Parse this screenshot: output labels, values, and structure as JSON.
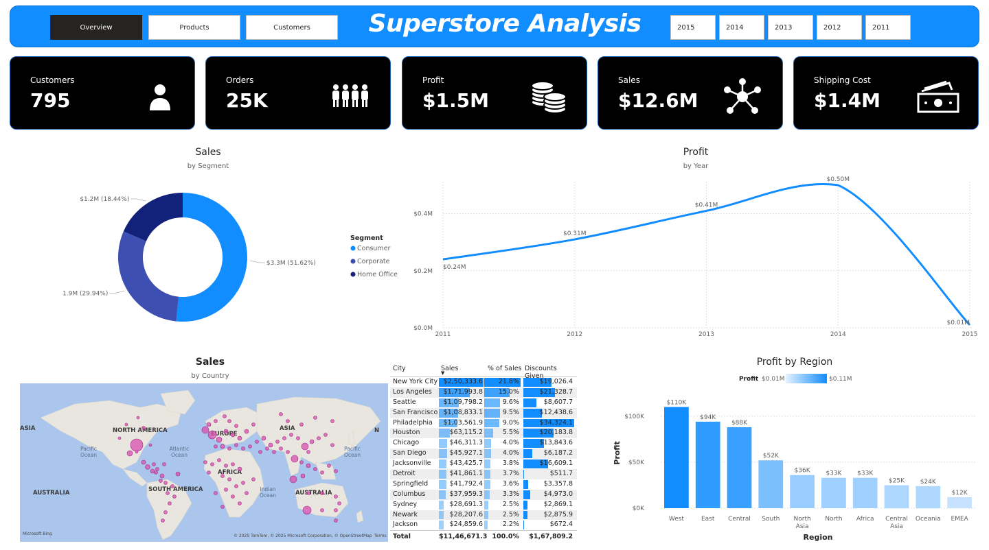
{
  "nav": {
    "tabs": [
      "Overview",
      "Products",
      "Customers"
    ],
    "active": "Overview",
    "title": "Superstore Analysis",
    "years": [
      "2015",
      "2014",
      "2013",
      "2012",
      "2011"
    ]
  },
  "kpis": [
    {
      "label": "Customers",
      "value": "795",
      "icon": "person-icon"
    },
    {
      "label": "Orders",
      "value": "25K",
      "icon": "people-group-icon"
    },
    {
      "label": "Profit",
      "value": "$1.5M",
      "icon": "coins-icon"
    },
    {
      "label": "Sales",
      "value": "$12.6M",
      "icon": "network-icon"
    },
    {
      "label": "Shipping Cost",
      "value": "$1.4M",
      "icon": "cash-icon"
    }
  ],
  "donut": {
    "title": "Sales",
    "subtitle": "by Segment",
    "legend_title": "Segment",
    "segments": [
      {
        "name": "Consumer",
        "value": 3.3,
        "label": "$3.3M (51.62%)",
        "pct": 51.62,
        "color": "#118dff"
      },
      {
        "name": "Corporate",
        "value": 1.9,
        "label": "$1.9M (29.94%)",
        "pct": 29.94,
        "color": "#3d4fb0"
      },
      {
        "name": "Home Office",
        "value": 1.2,
        "label": "$1.2M (18.44%)",
        "pct": 18.44,
        "color": "#12217a"
      }
    ]
  },
  "profit_line": {
    "title": "Profit",
    "subtitle": "by Year",
    "x": [
      2011,
      2012,
      2013,
      2014,
      2015
    ],
    "y": [
      0.24,
      0.31,
      0.41,
      0.5,
      0.01
    ],
    "labels": [
      "$0.24M",
      "$0.31M",
      "$0.41M",
      "$0.50M",
      "$0.01M"
    ],
    "yticks": [
      "$0.0M",
      "$0.2M",
      "$0.4M"
    ],
    "ylim": [
      0,
      0.5
    ],
    "color": "#118dff"
  },
  "map": {
    "title": "Sales",
    "subtitle": "by Country",
    "labels": {
      "na": "NORTH AMERICA",
      "eu": "EUROPE",
      "asia": "ASIA",
      "asia2": "ASIA",
      "asia3": "ASIA",
      "africa": "AFRICA",
      "sa": "SOUTH AMERICA",
      "au": "AUSTRALIA",
      "au2": "AUSTRALIA",
      "pacific1": "Pacific\nOcean",
      "atlantic": "Atlantic\nOcean",
      "indian": "Indian\nOcean",
      "pacific2": "Pacific\nOcean",
      "n": "N"
    },
    "bing": "Microsoft Bing",
    "copyright": "© 2025 TomTom, © 2025 Microsoft Corporation, © OpenStreetMap",
    "terms": "Terms"
  },
  "table": {
    "headers": [
      "City",
      "Sales",
      "% of Sales",
      "Discounts Given"
    ],
    "rows": [
      {
        "city": "New York City",
        "sales": "$2,50,333.6",
        "pct": "21.8%",
        "disc": "$19,026.4",
        "s": 1.0,
        "p": 1.0,
        "d": 0.55
      },
      {
        "city": "Los Angeles",
        "sales": "$1,71,993.8",
        "pct": "15.0%",
        "disc": "$21,328.7",
        "s": 0.69,
        "p": 0.69,
        "d": 0.62
      },
      {
        "city": "Seattle",
        "sales": "$1,09,798.2",
        "pct": "9.6%",
        "disc": "$8,607.7",
        "s": 0.44,
        "p": 0.44,
        "d": 0.25
      },
      {
        "city": "San Francisco",
        "sales": "$1,08,833.1",
        "pct": "9.5%",
        "disc": "$12,438.6",
        "s": 0.43,
        "p": 0.43,
        "d": 0.36
      },
      {
        "city": "Philadelphia",
        "sales": "$1,03,561.9",
        "pct": "9.0%",
        "disc": "$34,324.1",
        "s": 0.41,
        "p": 0.41,
        "d": 1.0
      },
      {
        "city": "Houston",
        "sales": "$63,115.2",
        "pct": "5.5%",
        "disc": "$20,183.8",
        "s": 0.25,
        "p": 0.25,
        "d": 0.59
      },
      {
        "city": "Chicago",
        "sales": "$46,311.3",
        "pct": "4.0%",
        "disc": "$13,843.6",
        "s": 0.18,
        "p": 0.18,
        "d": 0.4
      },
      {
        "city": "San Diego",
        "sales": "$45,927.1",
        "pct": "4.0%",
        "disc": "$6,187.2",
        "s": 0.18,
        "p": 0.18,
        "d": 0.18
      },
      {
        "city": "Jacksonville",
        "sales": "$43,425.7",
        "pct": "3.8%",
        "disc": "$16,609.1",
        "s": 0.17,
        "p": 0.17,
        "d": 0.48
      },
      {
        "city": "Detroit",
        "sales": "$41,861.1",
        "pct": "3.7%",
        "disc": "$511.7",
        "s": 0.17,
        "p": 0.17,
        "d": 0.01
      },
      {
        "city": "Springfield",
        "sales": "$41,792.4",
        "pct": "3.6%",
        "disc": "$3,357.8",
        "s": 0.17,
        "p": 0.17,
        "d": 0.1
      },
      {
        "city": "Columbus",
        "sales": "$37,959.3",
        "pct": "3.3%",
        "disc": "$4,973.0",
        "s": 0.15,
        "p": 0.15,
        "d": 0.14
      },
      {
        "city": "Sydney",
        "sales": "$28,691.3",
        "pct": "2.5%",
        "disc": "$2,869.1",
        "s": 0.11,
        "p": 0.11,
        "d": 0.08
      },
      {
        "city": "Newark",
        "sales": "$28,207.6",
        "pct": "2.5%",
        "disc": "$2,875.9",
        "s": 0.11,
        "p": 0.11,
        "d": 0.08
      },
      {
        "city": "Jackson",
        "sales": "$24,859.6",
        "pct": "2.2%",
        "disc": "$672.4",
        "s": 0.1,
        "p": 0.1,
        "d": 0.02
      }
    ],
    "total": {
      "label": "Total",
      "sales": "$11,46,671.3",
      "pct": "100.0%",
      "disc": "$1,67,809.2"
    }
  },
  "chart_data": {
    "type": "bar",
    "title": "Profit by Region",
    "xlabel": "Region",
    "ylabel": "Profit",
    "legend_title": "Profit",
    "legend_min": "$0.01M",
    "legend_max": "$0.11M",
    "categories": [
      "West",
      "East",
      "Central",
      "South",
      "North Asia",
      "North",
      "Africa",
      "Central Asia",
      "Oceania",
      "EMEA"
    ],
    "values": [
      110,
      94,
      88,
      52,
      36,
      33,
      33,
      25,
      24,
      12
    ],
    "value_labels": [
      "$110K",
      "$94K",
      "$88K",
      "$52K",
      "$36K",
      "$33K",
      "$33K",
      "$25K",
      "$24K",
      "$12K"
    ],
    "yticks": [
      "$0K",
      "$50K",
      "$100K"
    ],
    "ylim": [
      0,
      120
    ]
  }
}
